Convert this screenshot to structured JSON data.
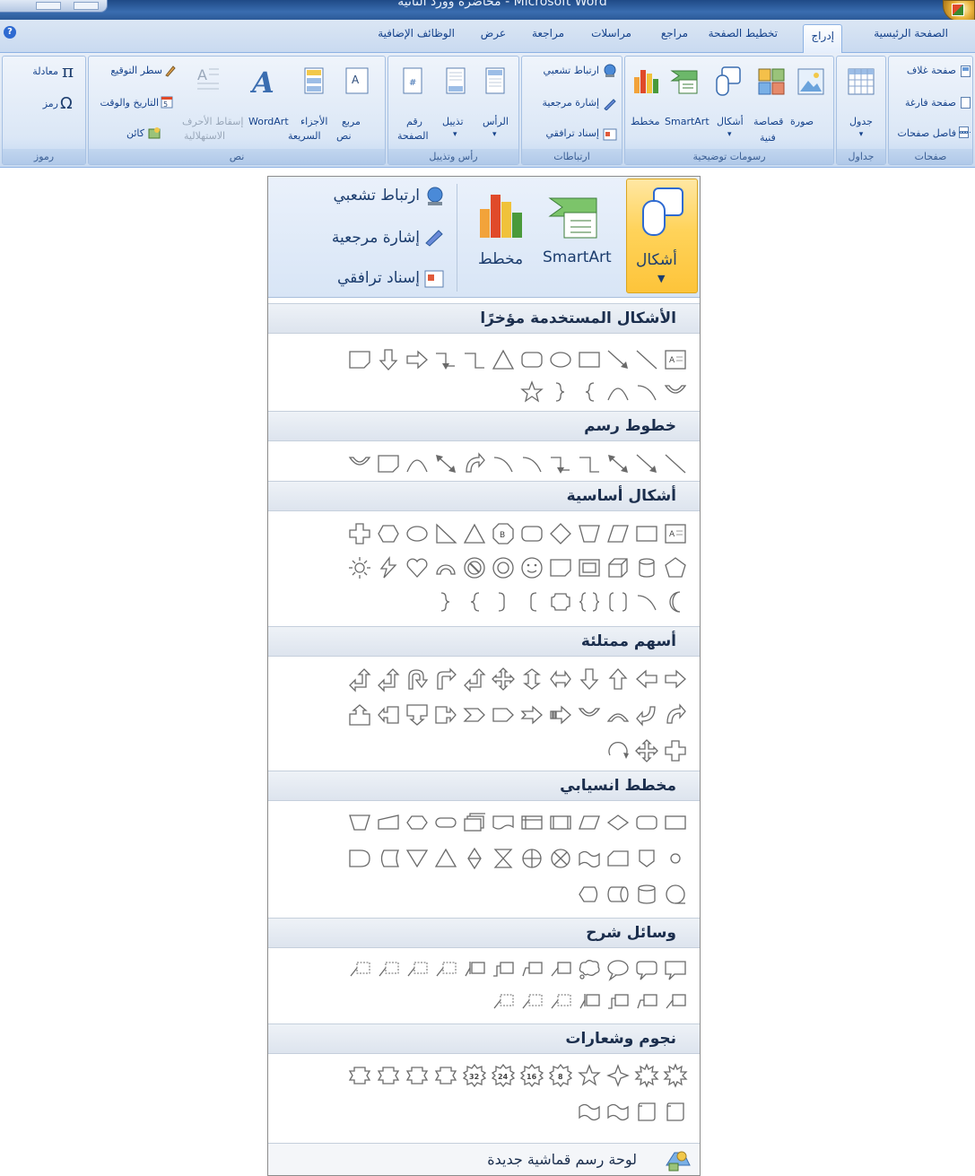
{
  "window": {
    "title": "محاضرة وورد الثانية - Microsoft Word"
  },
  "tabs": [
    "الصفحة الرئيسية",
    "إدراج",
    "تخطيط الصفحة",
    "مراجع",
    "مراسلات",
    "مراجعة",
    "عرض",
    "الوظائف الإضافية"
  ],
  "active_tab": "إدراج",
  "ribbon": {
    "pages": {
      "label": "صفحات",
      "cover": "صفحة غلاف",
      "blank": "صفحة فارغة",
      "break": "فاصل صفحات"
    },
    "tables": {
      "label": "جداول",
      "table": "جدول"
    },
    "illustrations": {
      "label": "رسومات توضيحية",
      "picture": "صورة",
      "clipart1": "قصاصة",
      "clipart2": "فنية",
      "shapes": "أشكال",
      "smartart": "SmartArt",
      "chart": "مخطط"
    },
    "links": {
      "label": "ارتباطات",
      "hyperlink": "ارتباط تشعبي",
      "bookmark": "إشارة مرجعية",
      "crossref": "إسناد ترافقي"
    },
    "header_footer": {
      "label": "رأس وتذييل",
      "header": "الرأس",
      "footer": "تذييل",
      "pagenum1": "رقم",
      "pagenum2": "الصفحة"
    },
    "text": {
      "label": "نص",
      "textbox1": "مربع",
      "textbox2": "نص",
      "quickparts1": "الأجزاء",
      "quickparts2": "السريعة",
      "wordart": "WordArt",
      "dropcap1": "إسقاط الأحرف",
      "dropcap2": "الاستهلالية",
      "signature": "سطر التوقيع",
      "datetime": "التاريخ والوقت",
      "object": "كائن"
    },
    "symbols": {
      "label": "رموز",
      "equation": "معادلة",
      "symbol": "رمز"
    }
  },
  "panel": {
    "shapes_label": "أشكال",
    "smartart_label": "SmartArt",
    "chart_label": "مخطط",
    "hyperlink": "ارتباط تشعبي",
    "bookmark": "إشارة مرجعية",
    "crossref": "إسناد ترافقي",
    "sections": [
      {
        "title": "الأشكال المستخدمة مؤخرًا"
      },
      {
        "title": "خطوط رسم"
      },
      {
        "title": "أشكال أساسية"
      },
      {
        "title": "أسهم ممتلئة"
      },
      {
        "title": "مخطط انسيابي"
      },
      {
        "title": "وسائل شرح"
      },
      {
        "title": "نجوم وشعارات"
      }
    ],
    "footer_label": "لوحة رسم قماشية جديدة"
  }
}
